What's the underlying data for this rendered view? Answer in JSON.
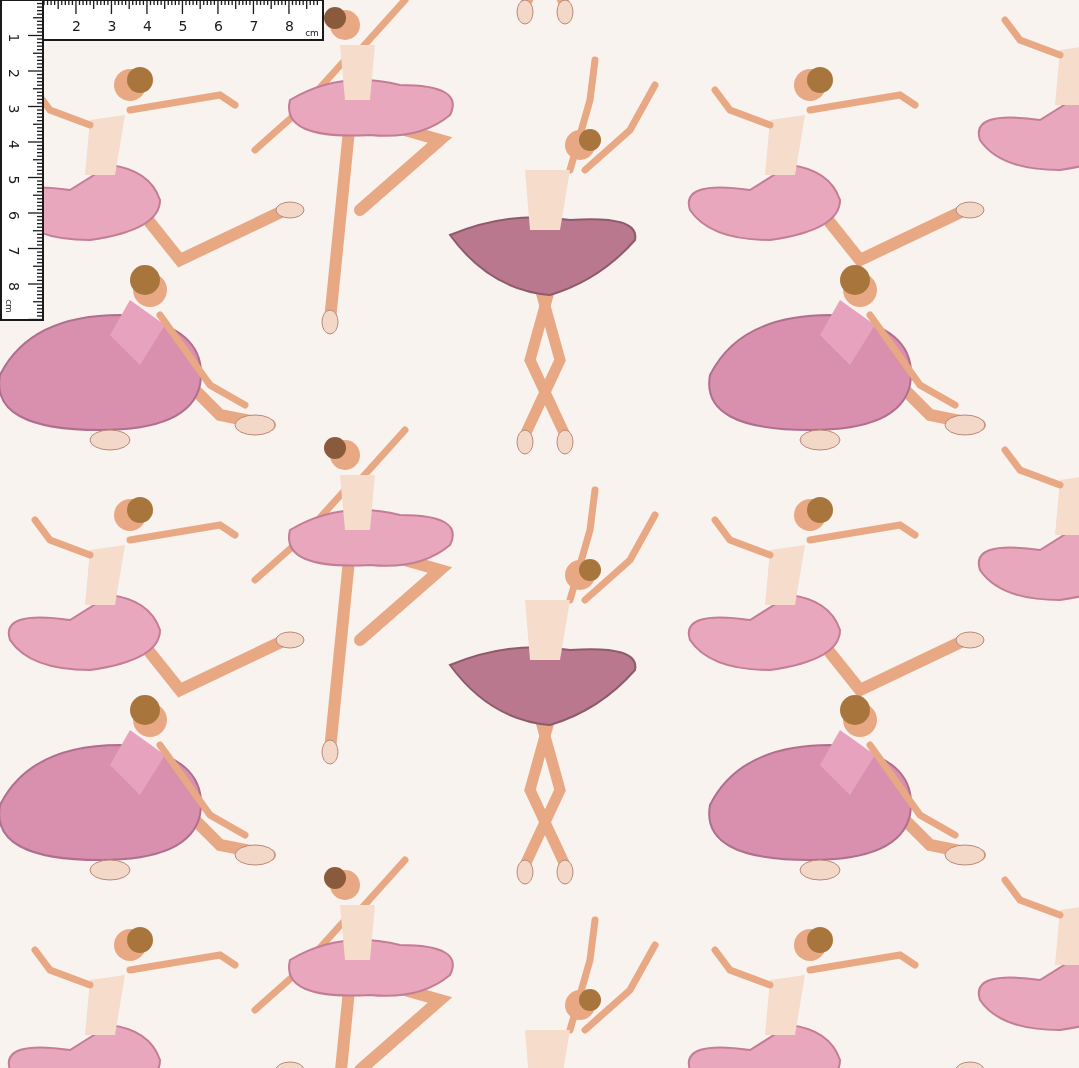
{
  "ruler": {
    "horizontal_labels": [
      "2",
      "3",
      "4",
      "5",
      "6",
      "7",
      "8"
    ],
    "horizontal_unit": "cm",
    "vertical_labels": [
      "1",
      "2",
      "3",
      "4",
      "5",
      "6",
      "7",
      "8"
    ],
    "vertical_unit": "cm"
  }
}
